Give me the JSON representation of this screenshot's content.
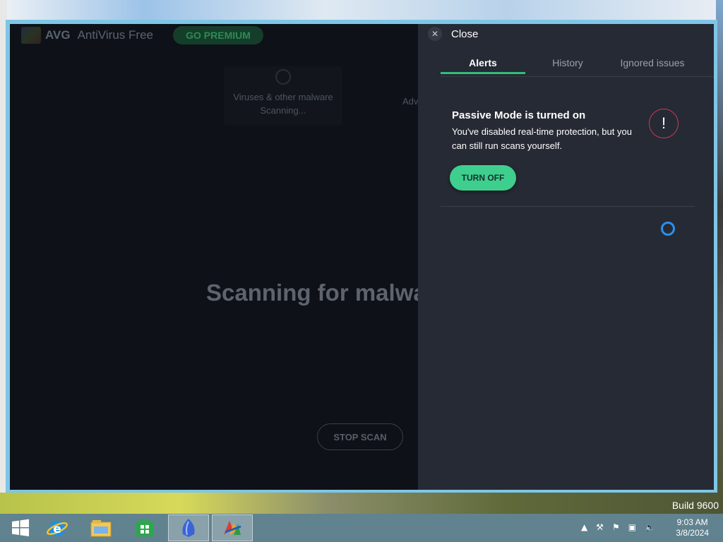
{
  "desktop": {
    "build_text": "Build 9600"
  },
  "app": {
    "brand": "AVG",
    "product": "AntiVirus Free",
    "premium_label": "GO PREMIUM",
    "scan_card": {
      "title": "Viruses & other malware",
      "status": "Scanning..."
    },
    "adv_partial": "Adv",
    "main_heading": "Scanning for malwa",
    "stop_scan_label": "STOP SCAN"
  },
  "panel": {
    "close_label": "Close",
    "tabs": [
      {
        "label": "Alerts",
        "active": true
      },
      {
        "label": "History",
        "active": false
      },
      {
        "label": "Ignored issues",
        "active": false
      }
    ],
    "alert": {
      "title": "Passive Mode is turned on",
      "description": "You've disabled real-time protection, but you can still run scans yourself.",
      "button_label": "TURN OFF",
      "icon": "exclamation-icon"
    }
  },
  "taskbar": {
    "items": [
      "windows-start",
      "internet-explorer",
      "file-explorer",
      "windows-store",
      "app-shield",
      "avg-app"
    ],
    "clock_time": "9:03 AM",
    "clock_date": "3/8/2024"
  },
  "colors": {
    "accent_green": "#3ecf8e",
    "panel_bg": "#262a34",
    "warning_ring": "#c23d5a",
    "spinner_blue": "#2a8ff0"
  }
}
